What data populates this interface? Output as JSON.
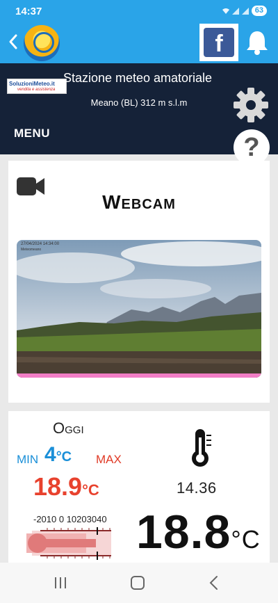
{
  "status_bar": {
    "time": "14:37",
    "battery": "63"
  },
  "header": {
    "brand_line1": "SoluzioniMeteo.it",
    "brand_line2": "vendita e assistenza",
    "title": "Stazione meteo amatoriale",
    "subtitle": "Meano (BL) 312 m s.l.m",
    "menu_label": "MENU",
    "help_label": "?"
  },
  "appbar": {
    "facebook_label": "f"
  },
  "webcam": {
    "title": "Webcam",
    "stamp_line1": "27/04/2024 14:34:00",
    "stamp_line2": "Meteomeano"
  },
  "weather": {
    "today_label": "Oggi",
    "min_label": "MIN",
    "min_value": "4",
    "min_unit": "°C",
    "max_label": "MAX",
    "max_value": "18.9",
    "max_unit": "°C",
    "time": "14.36",
    "scale_labels": "-2010 0 10203040",
    "current_temp": "18.8",
    "current_unit": "°C",
    "gauge_level_celsius": 18.8
  },
  "colors": {
    "primary": "#2aa4e8",
    "header_bg": "#152238",
    "min_color": "#1a8fd8",
    "max_color": "#e8422e"
  }
}
